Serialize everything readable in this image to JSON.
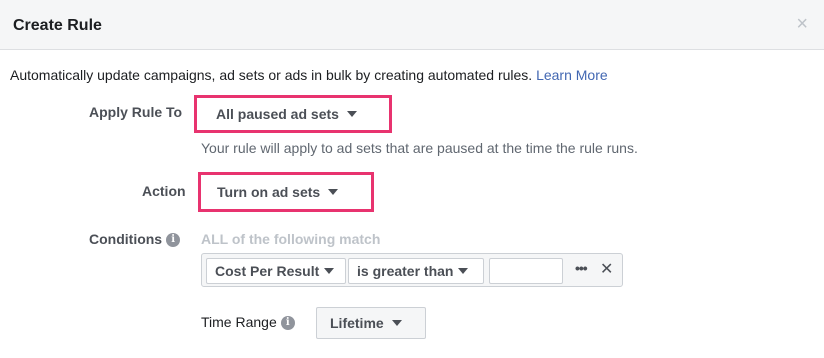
{
  "dialog": {
    "title": "Create Rule",
    "close_glyph": "×",
    "description": "Automatically update campaigns, ad sets or ads in bulk by creating automated rules.",
    "learn_more": "Learn More"
  },
  "apply_rule": {
    "label": "Apply Rule To",
    "selected": "All paused ad sets",
    "hint": "Your rule will apply to ad sets that are paused at the time the rule runs."
  },
  "action": {
    "label": "Action",
    "selected": "Turn on ad sets"
  },
  "conditions": {
    "label": "Conditions",
    "hint": "ALL of the following match",
    "metric": "Cost Per Result",
    "operator": "is greater than",
    "value": "",
    "more_glyph": "•••",
    "remove_glyph": "✕"
  },
  "time_range": {
    "label": "Time Range",
    "selected": "Lifetime"
  },
  "icons": {
    "info": "i"
  },
  "colors": {
    "highlight": "#e8336f",
    "link": "#4267b2"
  }
}
